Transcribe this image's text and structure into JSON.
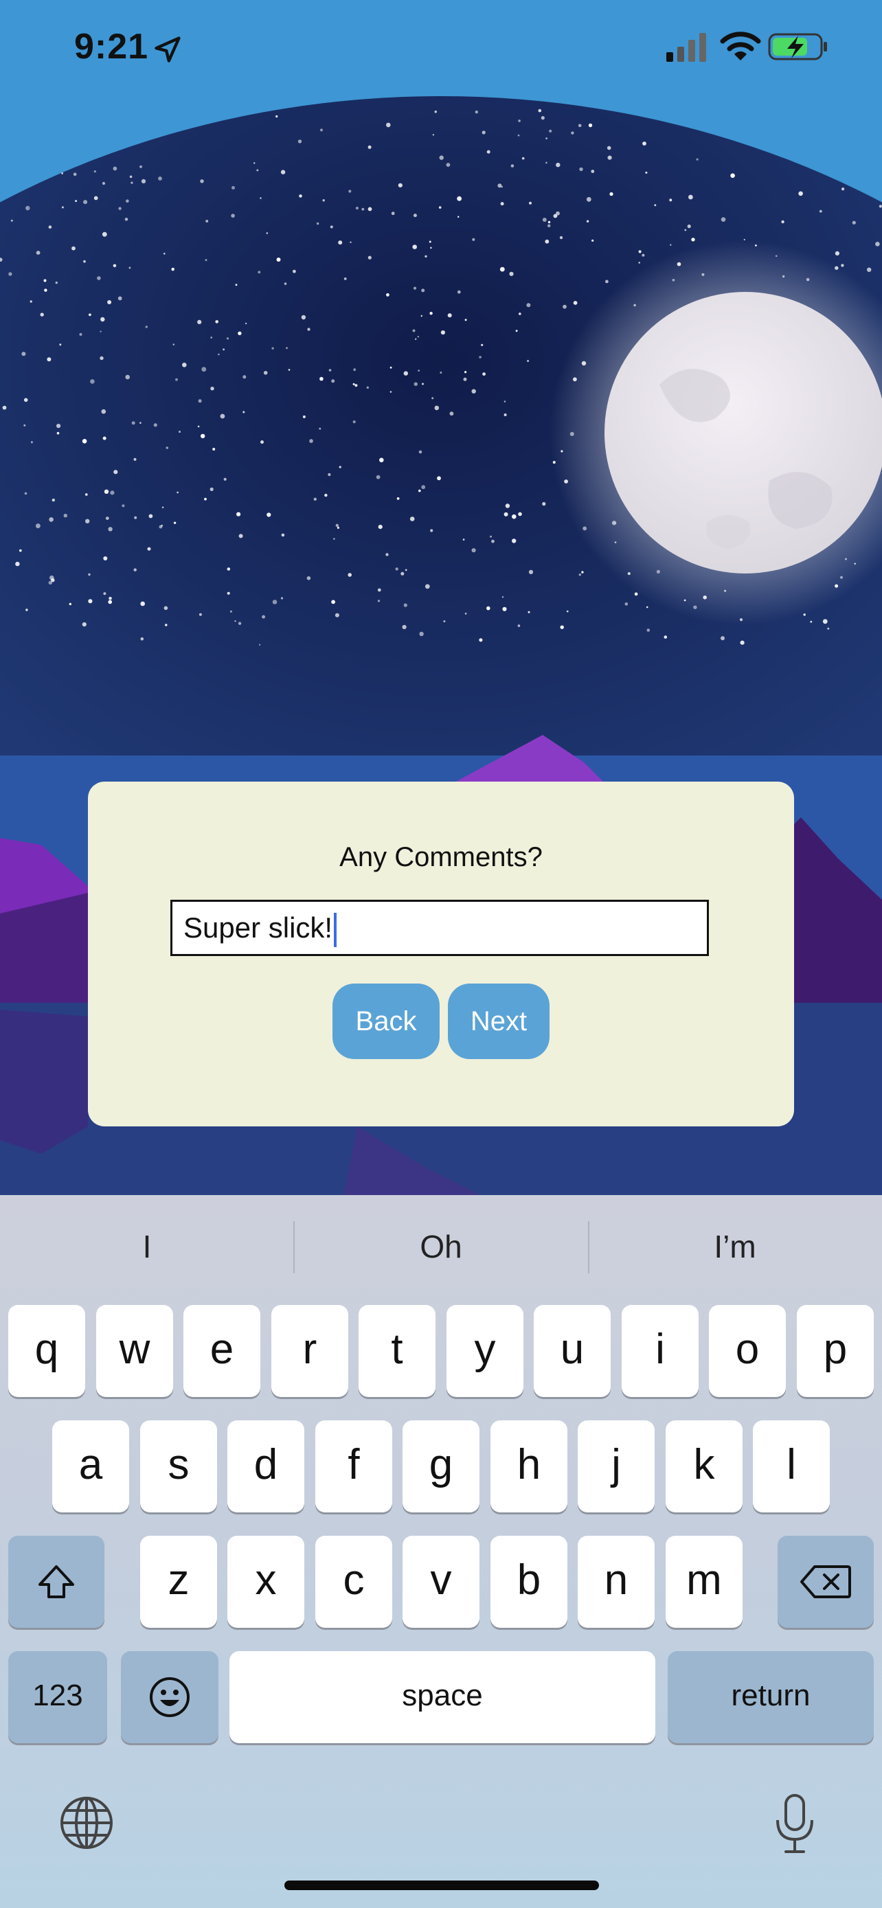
{
  "status_bar": {
    "time": "9:21",
    "icons": [
      "location-arrow-icon",
      "cellular-signal-icon",
      "wifi-icon",
      "battery-charging-icon"
    ],
    "battery_color": "#4cd964"
  },
  "dialog": {
    "title": "Any Comments?",
    "input_value": "Super slick!",
    "back_label": "Back",
    "next_label": "Next",
    "background": "#f0f1db",
    "button_color": "#5aa3d6"
  },
  "keyboard": {
    "suggestions": [
      "I",
      "Oh",
      "I’m"
    ],
    "row1": [
      "q",
      "w",
      "e",
      "r",
      "t",
      "y",
      "u",
      "i",
      "o",
      "p"
    ],
    "row2": [
      "a",
      "s",
      "d",
      "f",
      "g",
      "h",
      "j",
      "k",
      "l"
    ],
    "row3": [
      "z",
      "x",
      "c",
      "v",
      "b",
      "n",
      "m"
    ],
    "numbers_label": "123",
    "space_label": "space",
    "return_label": "return",
    "icons": [
      "shift-icon",
      "delete-icon",
      "emoji-icon",
      "globe-icon",
      "microphone-icon"
    ]
  }
}
